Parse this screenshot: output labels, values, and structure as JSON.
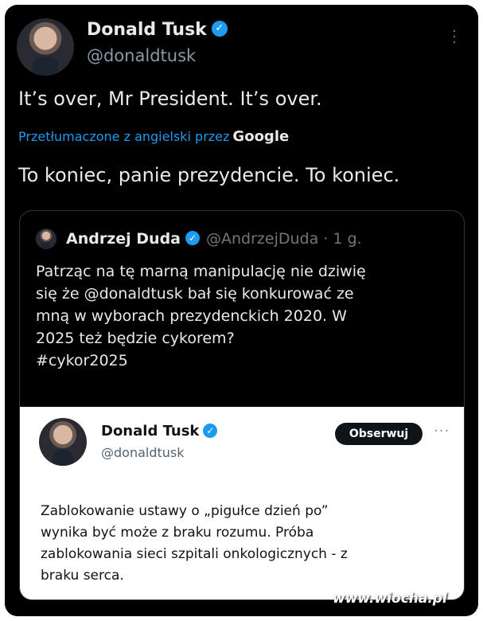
{
  "main_tweet": {
    "author_name": "Donald Tusk",
    "handle": "@donaldtusk",
    "text": "It’s over, Mr President. It’s over.",
    "translation_label": "Przetłumaczone z angielski przez",
    "translation_provider": "Google",
    "translated_text": "To koniec, panie prezydencie. To koniec."
  },
  "quoted_tweet": {
    "author_name": "Andrzej Duda",
    "handle": "@AndrzejDuda",
    "time": "· 1 g.",
    "lines": [
      "Patrząc na tę marną manipulację nie dziwię",
      "się że @donaldtusk bał się konkurować ze",
      "mną w wyborach prezydenckich 2020. W",
      "2025 też będzie cykorem?",
      "#cykor2025"
    ]
  },
  "embedded_tweet": {
    "author_name": "Donald Tusk",
    "handle": "@donaldtusk",
    "follow_label": "Obserwuj",
    "more_label": "···",
    "lines": [
      "Zablokowanie ustawy o „pigułce dzień po”",
      "wynika być może z braku rozumu. Próba",
      "zablokowania sieci szpitali onkologicznych -  z",
      "braku serca."
    ]
  },
  "icons": {
    "verified": "verified-badge-icon",
    "menu": "vertical-dots-icon"
  },
  "colors": {
    "background": "#000000",
    "link": "#1d9bf0",
    "verified": "#1d9bf0"
  },
  "watermark": "www.wiocha.pl"
}
